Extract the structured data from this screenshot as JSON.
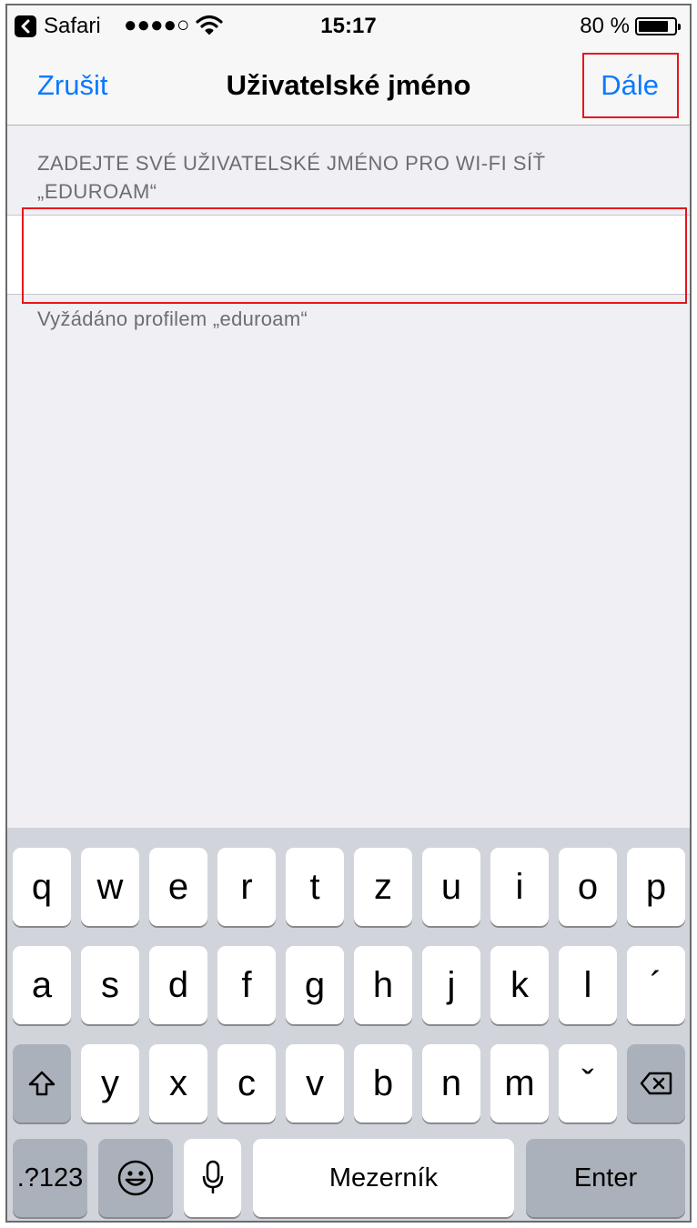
{
  "status_bar": {
    "back_app": "Safari",
    "signal": "●●●●○",
    "time": "15:17",
    "battery": "80 %"
  },
  "nav": {
    "cancel_label": "Zrušit",
    "title": "Uživatelské jméno",
    "next_label": "Dále"
  },
  "form": {
    "section_header": "ZADEJTE SVÉ UŽIVATELSKÉ JMÉNO PRO WI-FI SÍŤ „EDUROAM“",
    "username_value": "",
    "footer": "Vyžádáno profilem „eduroam“"
  },
  "keyboard": {
    "row1": [
      "q",
      "w",
      "e",
      "r",
      "t",
      "z",
      "u",
      "i",
      "o",
      "p"
    ],
    "row2": [
      "a",
      "s",
      "d",
      "f",
      "g",
      "h",
      "j",
      "k",
      "l",
      "´"
    ],
    "row3": [
      "y",
      "x",
      "c",
      "v",
      "b",
      "n",
      "m",
      "ˇ"
    ],
    "numbers_label": ".?123",
    "space_label": "Mezerník",
    "enter_label": "Enter"
  },
  "colors": {
    "accent": "#0a7aff",
    "highlight": "#e8141e",
    "background": "#efeff4",
    "keyboard": "#d1d5db"
  }
}
